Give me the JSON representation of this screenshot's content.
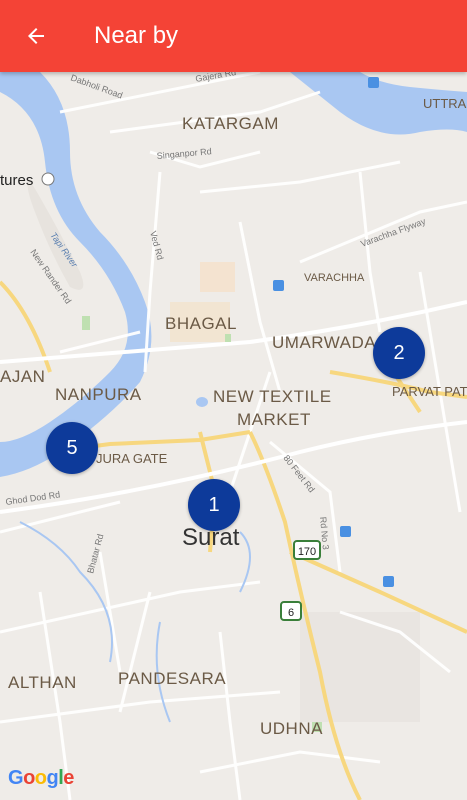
{
  "header": {
    "title": "Near by",
    "back_icon": "arrow-back-icon"
  },
  "colors": {
    "toolbar": "#f44336",
    "marker": "#0d3a9a",
    "water": "#a9c7f2",
    "land": "#efece8"
  },
  "markers": [
    {
      "label": "1"
    },
    {
      "label": "2"
    },
    {
      "label": "5"
    }
  ],
  "map_labels": {
    "katargam": "KATARGAM",
    "bhagal": "BHAGAL",
    "umarwada": "UMARWADA",
    "nanpura": "NANPURA",
    "new_textile": "NEW TEXTILE",
    "market": "MARKET",
    "surat": "Surat",
    "parvat": "PARVAT PAT",
    "althan": "ALTHAN",
    "pandesara": "PANDESARA",
    "udhna": "UDHNA",
    "varachha": "VARACHHA",
    "uttra": "UTTRA",
    "ajan": "AJAN",
    "jura_gate": "JURA GATE",
    "tures": "tures",
    "dabholi_road": "Dabholi Road",
    "gajera_rd": "Gajera Rd",
    "singanpor_rd": "Singanpor Rd",
    "ved_rd": "Ved Rd",
    "tapi_river": "Tapi River",
    "new_rander_rd": "New Rander Rd",
    "varachha_flyway": "Varachha Flyway",
    "feet_rd": "80 Feet Rd",
    "rd_no_3": "Rd No 3",
    "ghod_dod_rd": "Ghod Dod Rd",
    "bhatar_rd": "Bhatar Rd",
    "shield_170": "170",
    "shield_6": "6"
  },
  "attribution": "Google"
}
